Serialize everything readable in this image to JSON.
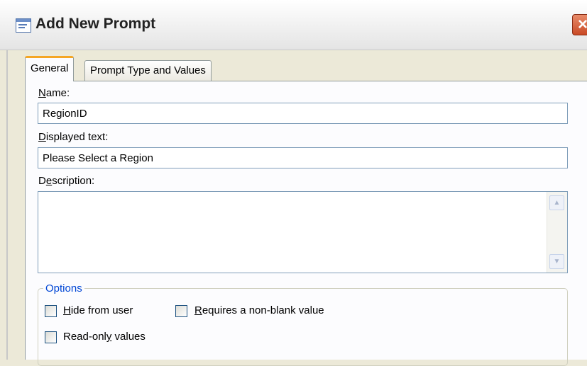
{
  "window": {
    "title": "Add New Prompt",
    "close_glyph": "×",
    "title_icon": "form-window-icon"
  },
  "tabs": [
    {
      "label": "General",
      "active": true
    },
    {
      "label": "Prompt Type and Values",
      "active": false
    }
  ],
  "form": {
    "name_label_hotkey": "N",
    "name_label_rest": "ame:",
    "name_value": "RegionID",
    "displayed_label_hotkey": "D",
    "displayed_label_rest": "isplayed text:",
    "displayed_value": "Please Select a Region",
    "description_label_pre": "D",
    "description_label_hotkey": "e",
    "description_label_rest": "scription:",
    "description_value": ""
  },
  "options": {
    "legend": "Options",
    "hide_from_user": {
      "hotkey": "H",
      "rest": "ide from user",
      "checked": false
    },
    "requires_non_blank": {
      "hotkey": "R",
      "rest": "equires a non-blank value",
      "checked": false
    },
    "read_only": {
      "pre": "Read-onl",
      "hotkey": "y",
      "rest": " values",
      "checked": false
    }
  },
  "scrollbar": {
    "up_glyph": "▲",
    "down_glyph": "▼"
  },
  "colors": {
    "dialog_bg": "#ece9d8",
    "panel_bg": "#fcfcfe",
    "tab_accent": "#f5a623",
    "options_legend": "#0046d5",
    "close_button": "#c94a25"
  }
}
